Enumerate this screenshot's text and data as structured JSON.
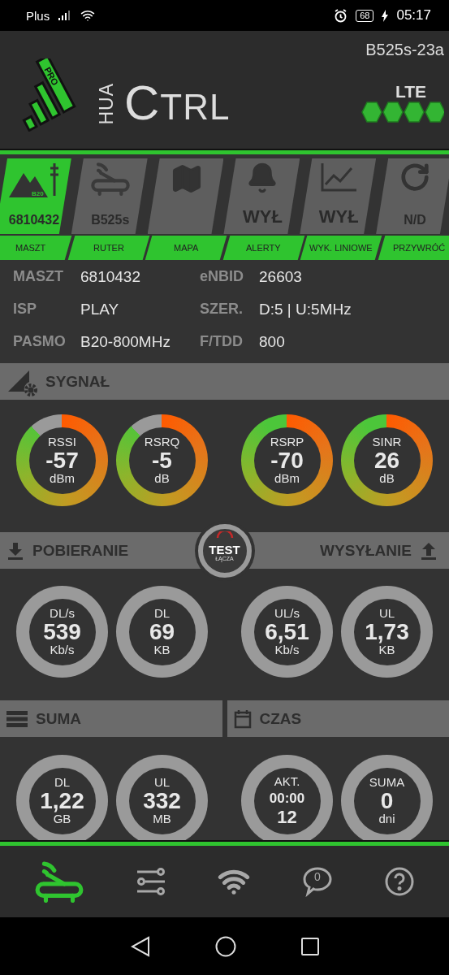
{
  "status_bar": {
    "carrier": "Plus",
    "battery": "68",
    "time": "05:17"
  },
  "header": {
    "logo_badge": "PRO",
    "title_prefix": "HUA",
    "title": "CTRL",
    "model": "B525s-23a",
    "network": "LTE"
  },
  "tabs": [
    {
      "kind": "mast",
      "value": "6810432",
      "icon_text": "B20",
      "label": "MASZT",
      "selected": true
    },
    {
      "kind": "router",
      "value": "B525s",
      "label": "RUTER",
      "selected": false
    },
    {
      "kind": "map",
      "label": "MAPA",
      "selected": false
    },
    {
      "kind": "alerts",
      "value": "WYŁ",
      "label": "ALERTY",
      "selected": false
    },
    {
      "kind": "chart",
      "value": "WYŁ",
      "label": "WYK. LINIOWE",
      "selected": false
    },
    {
      "kind": "reset",
      "value": "N/D",
      "label": "PRZYWRÓĆ",
      "selected": false
    }
  ],
  "info": [
    {
      "label": "MASZT",
      "value": "6810432"
    },
    {
      "label": "eNBID",
      "value": "26603"
    },
    {
      "label": "ISP",
      "value": "PLAY"
    },
    {
      "label": "SZER.",
      "value": "D:5 | U:5MHz"
    },
    {
      "label": "PASMO",
      "value": "B20-800MHz"
    },
    {
      "label": "F/TDD",
      "value": "800"
    }
  ],
  "signal": {
    "title": "SYGNAŁ",
    "gauges": [
      {
        "kind": "meter_gap",
        "label": "RSSI",
        "value": "-57",
        "unit": "dBm"
      },
      {
        "kind": "meter_gap",
        "label": "RSRQ",
        "value": "-5",
        "unit": "dB"
      },
      {
        "kind": "meter",
        "label": "RSRP",
        "value": "-70",
        "unit": "dBm"
      },
      {
        "kind": "meter",
        "label": "SINR",
        "value": "26",
        "unit": "dB"
      }
    ]
  },
  "transfer": {
    "download_title": "POBIERANIE",
    "upload_title": "WYSYŁANIE",
    "test_button": {
      "title": "TEST",
      "subtitle": "ŁĄCZA"
    },
    "gauges": [
      {
        "kind": "plain",
        "label": "DL/s",
        "value": "539",
        "unit": "Kb/s"
      },
      {
        "kind": "plain",
        "label": "DL",
        "value": "69",
        "unit": "KB"
      },
      {
        "kind": "plain",
        "label": "UL/s",
        "value": "6,51",
        "unit": "Kb/s"
      },
      {
        "kind": "plain",
        "label": "UL",
        "value": "1,73",
        "unit": "KB"
      }
    ]
  },
  "totals": {
    "sum_title": "SUMA",
    "time_title": "CZAS",
    "gauges": [
      {
        "kind": "plain",
        "label": "DL",
        "value": "1,22",
        "unit": "GB"
      },
      {
        "kind": "plain",
        "label": "UL",
        "value": "332",
        "unit": "MB"
      },
      {
        "kind": "time",
        "label": "AKT.",
        "value": "00:00",
        "unit": "12"
      },
      {
        "kind": "plain",
        "label": "SUMA",
        "value": "0",
        "unit": "dni"
      }
    ]
  },
  "bottom_nav": [
    {
      "kind": "router",
      "selected": true
    },
    {
      "kind": "settings",
      "selected": false
    },
    {
      "kind": "wifi",
      "selected": false
    },
    {
      "kind": "messages",
      "count": "0",
      "selected": false
    },
    {
      "kind": "help",
      "selected": false
    }
  ]
}
